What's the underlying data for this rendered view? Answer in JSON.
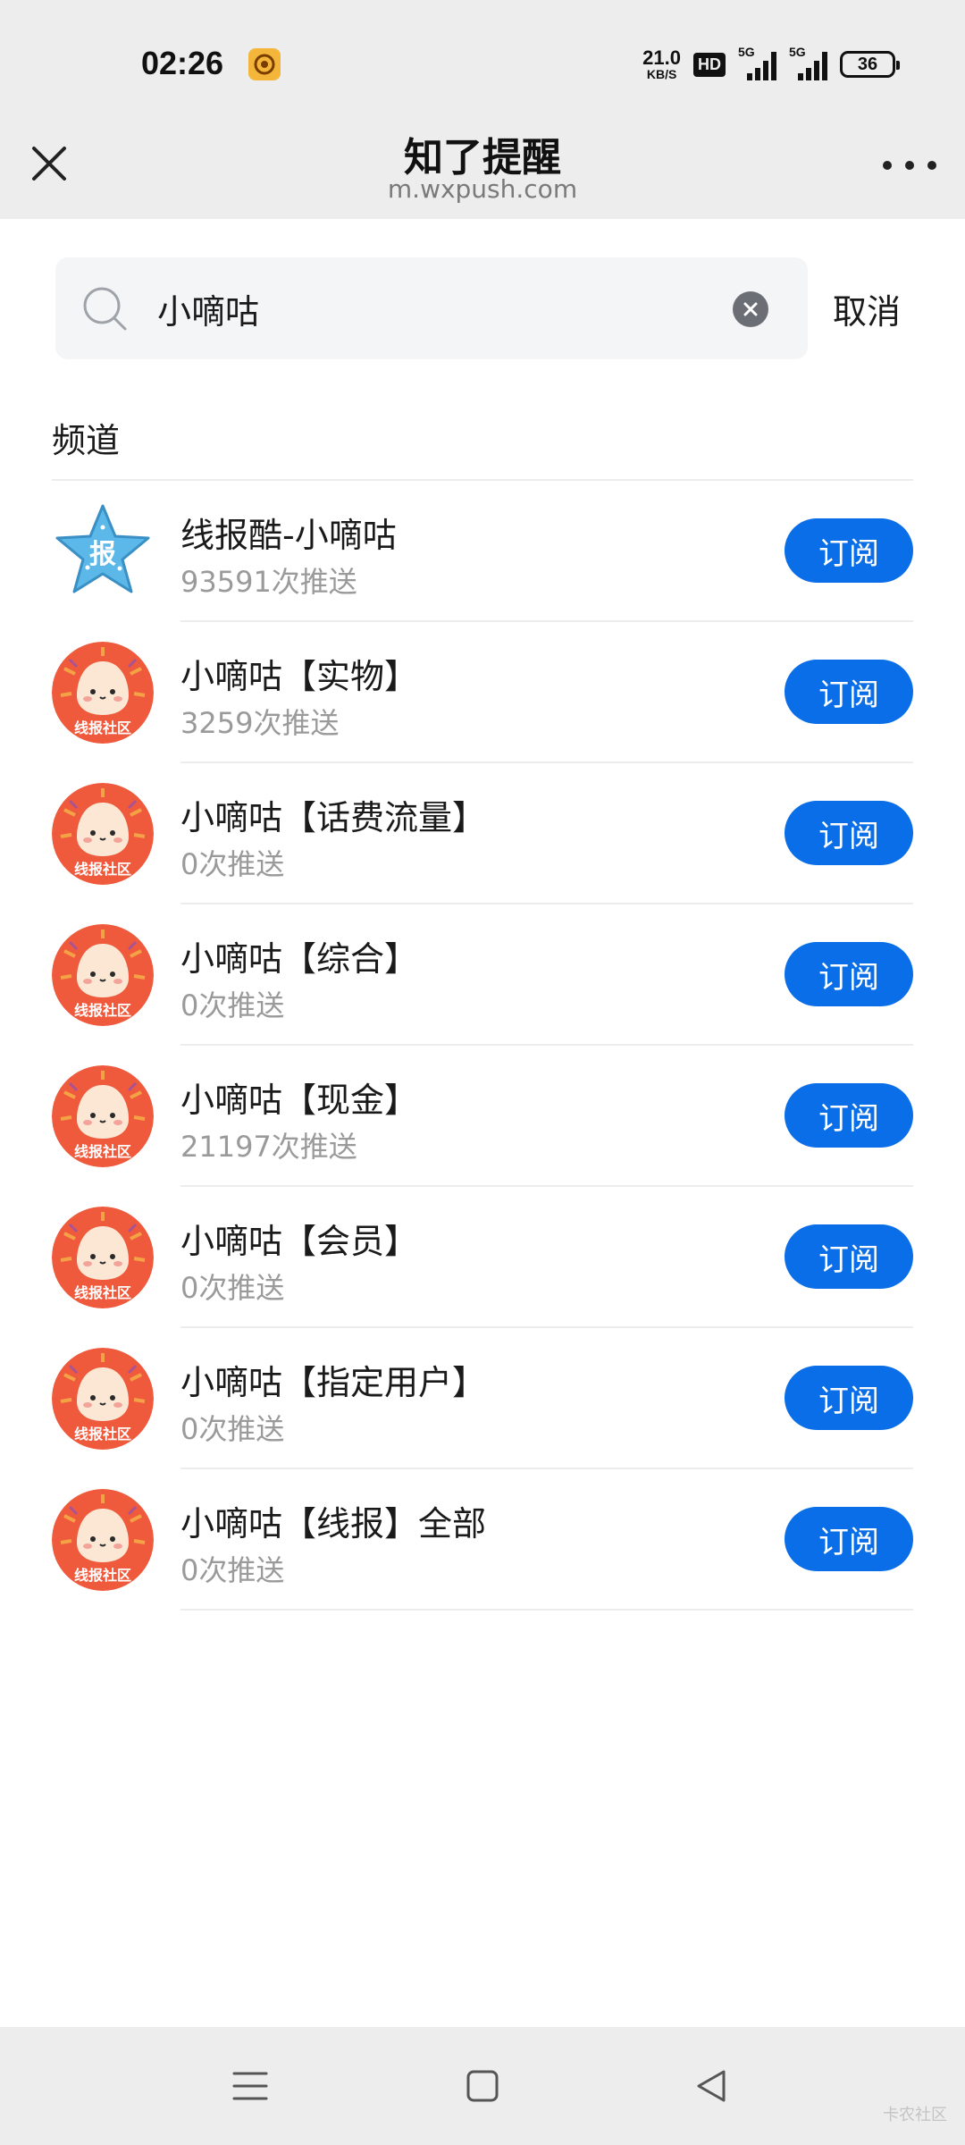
{
  "status_bar": {
    "time": "02:26",
    "net_speed_value": "21.0",
    "net_speed_unit": "KB/S",
    "hd_label": "HD",
    "signal1_label": "5G",
    "signal2_label": "5G",
    "battery": "36"
  },
  "header": {
    "title": "知了提醒",
    "url": "m.wxpush.com"
  },
  "search": {
    "value": "小嘀咕",
    "cancel_label": "取消"
  },
  "section": {
    "title": "频道"
  },
  "channels": [
    {
      "name": "线报酷-小嘀咕",
      "pushes": "93591次推送",
      "button": "订阅",
      "avatar": "star-badge"
    },
    {
      "name": "小嘀咕【实物】",
      "pushes": "3259次推送",
      "button": "订阅",
      "avatar": "mascot"
    },
    {
      "name": "小嘀咕【话费流量】",
      "pushes": "0次推送",
      "button": "订阅",
      "avatar": "mascot"
    },
    {
      "name": "小嘀咕【综合】",
      "pushes": "0次推送",
      "button": "订阅",
      "avatar": "mascot"
    },
    {
      "name": "小嘀咕【现金】",
      "pushes": "21197次推送",
      "button": "订阅",
      "avatar": "mascot"
    },
    {
      "name": "小嘀咕【会员】",
      "pushes": "0次推送",
      "button": "订阅",
      "avatar": "mascot"
    },
    {
      "name": "小嘀咕【指定用户】",
      "pushes": "0次推送",
      "button": "订阅",
      "avatar": "mascot"
    },
    {
      "name": "小嘀咕【线报】全部",
      "pushes": "0次推送",
      "button": "订阅",
      "avatar": "mascot"
    }
  ],
  "avatar_text": {
    "star": "报",
    "mascot": "线报社区"
  },
  "watermark": "卡农社区",
  "colors": {
    "accent": "#0a6ee8",
    "header_bg": "#ededed",
    "avatar_red": "#ef5a3c",
    "star_blue": "#5bb8e8"
  }
}
